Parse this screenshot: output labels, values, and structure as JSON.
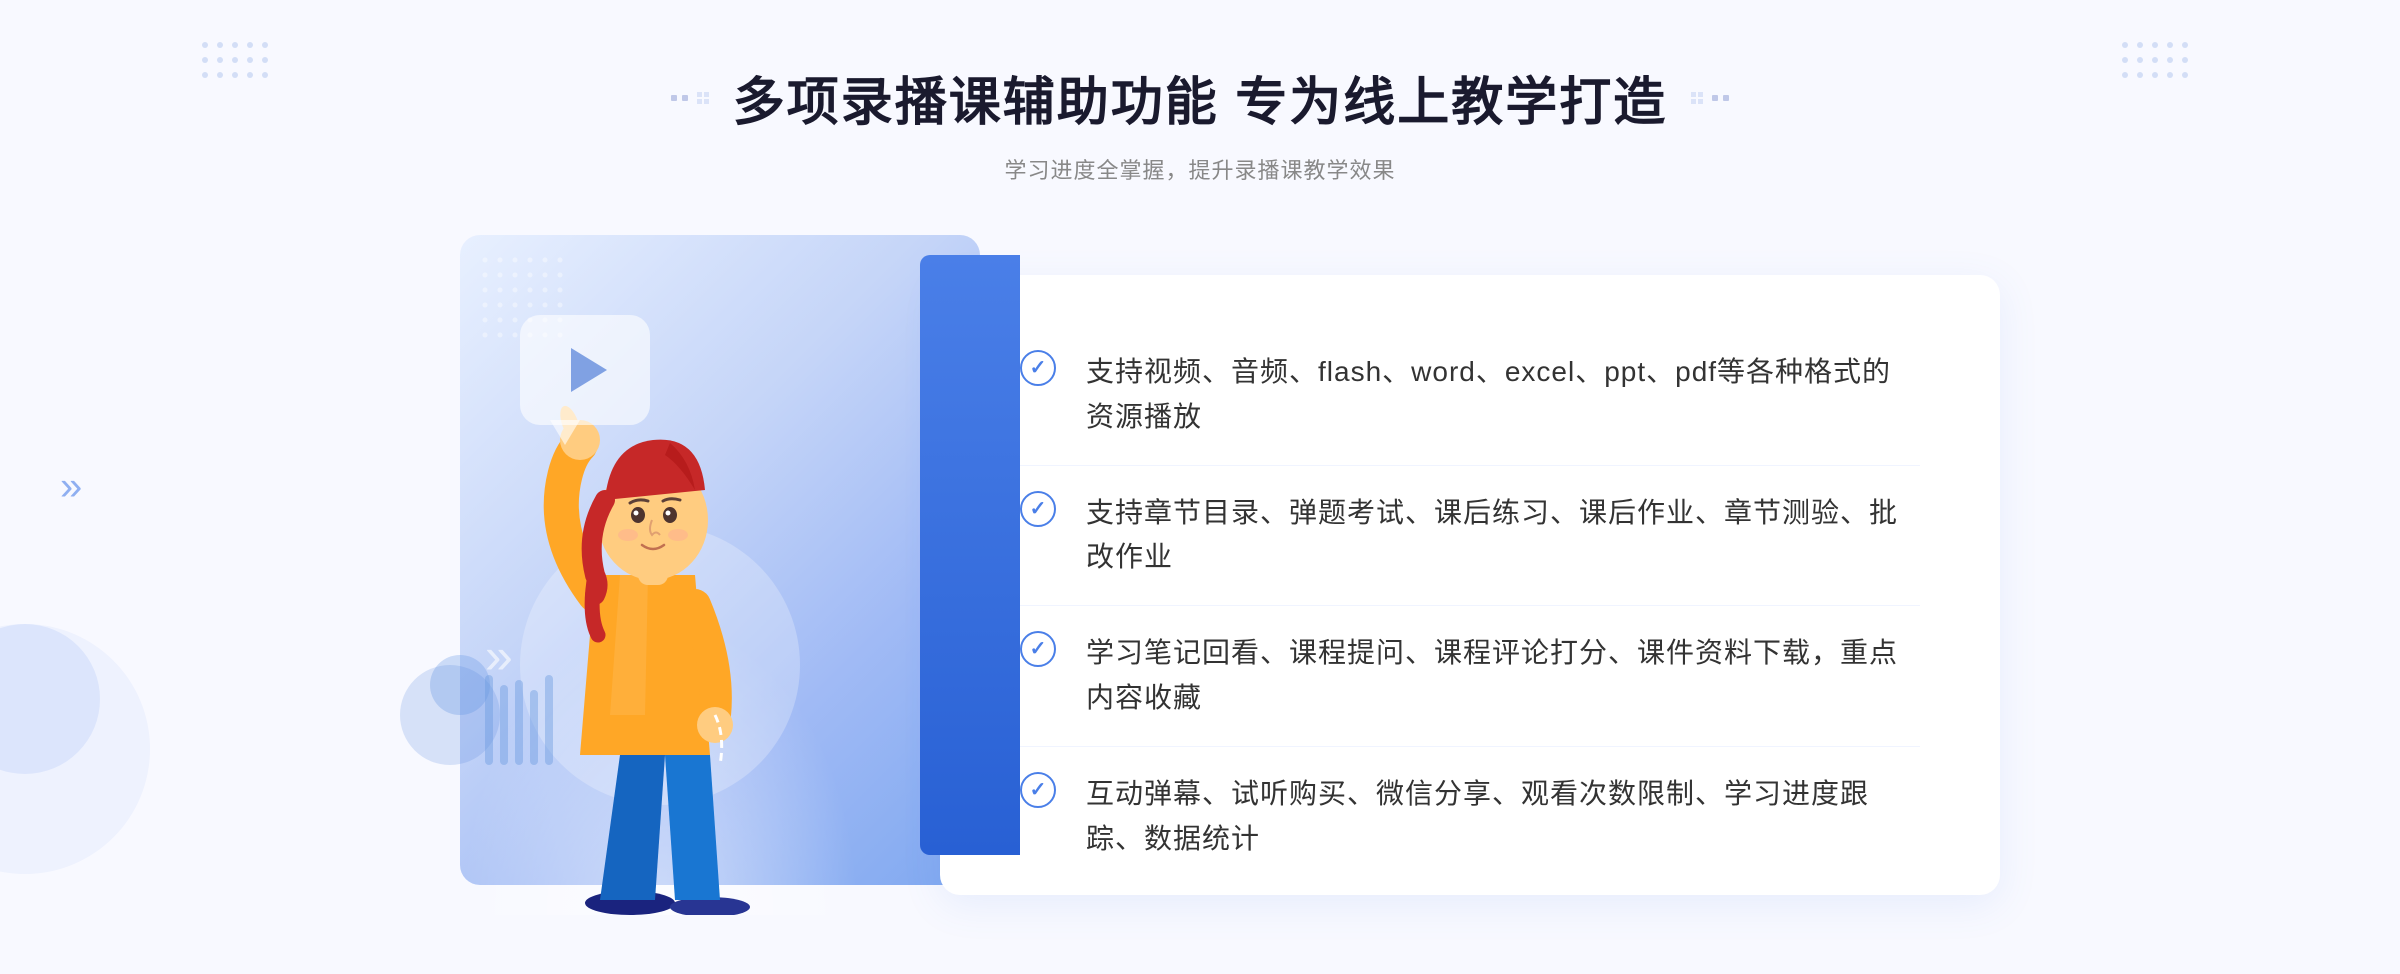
{
  "header": {
    "title": "多项录播课辅助功能 专为线上教学打造",
    "subtitle": "学习进度全掌握，提升录播课教学效果",
    "decorator_left": "❖",
    "decorator_right": "❖"
  },
  "features": [
    {
      "id": 1,
      "text": "支持视频、音频、flash、word、excel、ppt、pdf等各种格式的资源播放"
    },
    {
      "id": 2,
      "text": "支持章节目录、弹题考试、课后练习、课后作业、章节测验、批改作业"
    },
    {
      "id": 3,
      "text": "学习笔记回看、课程提问、课程评论打分、课件资料下载，重点内容收藏"
    },
    {
      "id": 4,
      "text": "互动弹幕、试听购买、微信分享、观看次数限制、学习进度跟踪、数据统计"
    }
  ],
  "colors": {
    "primary_blue": "#4a7fe8",
    "light_blue": "#e8f0ff",
    "title_color": "#1a1a2e",
    "text_color": "#333333",
    "subtitle_color": "#888888"
  }
}
